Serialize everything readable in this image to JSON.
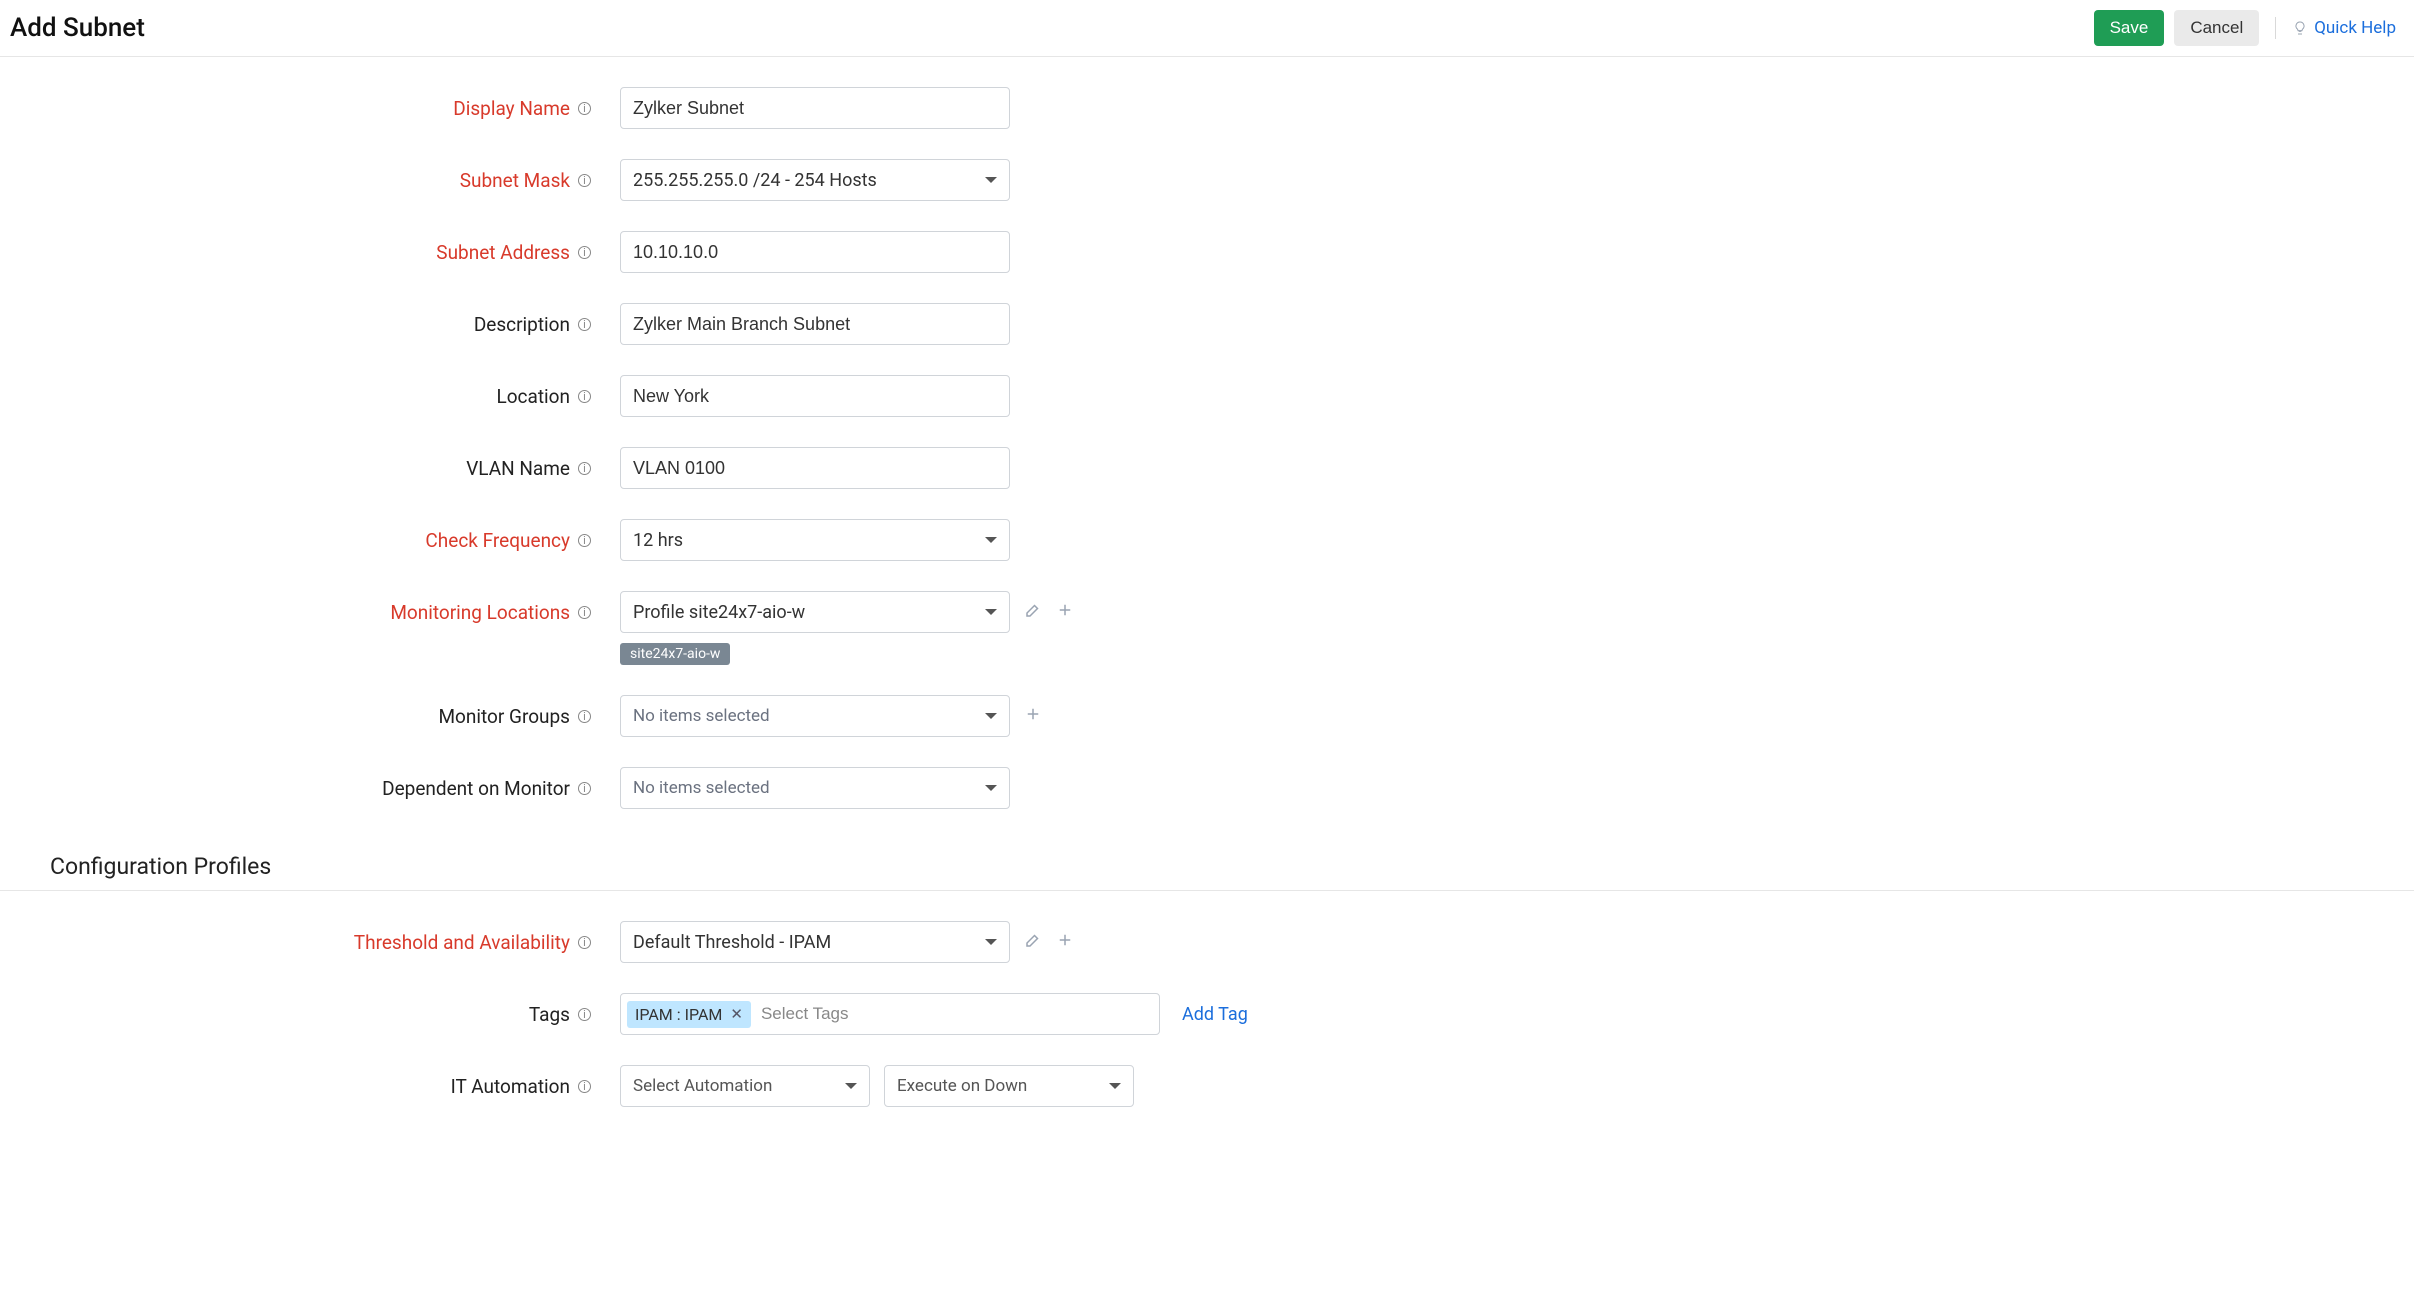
{
  "header": {
    "title": "Add Subnet",
    "save_label": "Save",
    "cancel_label": "Cancel",
    "quick_help_label": "Quick Help"
  },
  "labels": {
    "display_name": "Display Name",
    "subnet_mask": "Subnet Mask",
    "subnet_address": "Subnet Address",
    "description": "Description",
    "location": "Location",
    "vlan_name": "VLAN Name",
    "check_frequency": "Check Frequency",
    "monitoring_locations": "Monitoring Locations",
    "monitor_groups": "Monitor Groups",
    "dependent_on_monitor": "Dependent on Monitor",
    "threshold_availability": "Threshold and Availability",
    "tags": "Tags",
    "it_automation": "IT Automation"
  },
  "values": {
    "display_name": "Zylker Subnet",
    "subnet_mask": "255.255.255.0 /24 - 254 Hosts",
    "subnet_address": "10.10.10.0",
    "description": "Zylker Main Branch Subnet",
    "location": "New York",
    "vlan_name": "VLAN 0100",
    "check_frequency": "12 hrs",
    "monitoring_locations": "Profile site24x7-aio-w",
    "monitoring_locations_chip": "site24x7-aio-w",
    "monitor_groups": "No items selected",
    "dependent_on_monitor": "No items selected",
    "threshold_availability": "Default Threshold - IPAM",
    "tag_token": "IPAM : IPAM",
    "tag_placeholder": "Select Tags",
    "add_tag": "Add Tag",
    "automation_select": "Select Automation",
    "automation_trigger": "Execute on Down"
  },
  "sections": {
    "configuration_profiles": "Configuration Profiles"
  }
}
